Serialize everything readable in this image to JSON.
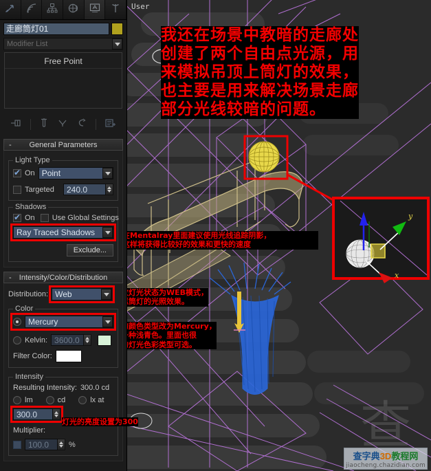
{
  "app": {
    "viewport_label": "User"
  },
  "command_panel": {
    "tabs": [
      {
        "name": "create",
        "icon": "arrow-pointer-icon"
      },
      {
        "name": "modify",
        "icon": "radiate-icon"
      },
      {
        "name": "hierarchy",
        "icon": "hierarchy-icon"
      },
      {
        "name": "motion",
        "icon": "motion-wheel-icon"
      },
      {
        "name": "display",
        "icon": "display-monitor-icon"
      },
      {
        "name": "utilities",
        "icon": "hammer-icon"
      }
    ],
    "object_name": "走廊筒灯01",
    "object_color": "#b0a11e",
    "modifier_list_placeholder": "Modifier List",
    "stack_item": "Free Point",
    "stack_tools": [
      {
        "name": "pin-stack-icon"
      },
      {
        "name": "show-end-result-icon"
      },
      {
        "name": "make-unique-icon"
      },
      {
        "name": "remove-modifier-icon"
      },
      {
        "name": "configure-sets-icon"
      }
    ]
  },
  "general_parameters": {
    "title": "General Parameters",
    "light_type": {
      "group_label": "Light Type",
      "on_label": "On",
      "on_checked": true,
      "type_value": "Point",
      "targeted_label": "Targeted",
      "targeted_checked": false,
      "target_distance": "240.0"
    },
    "shadows": {
      "group_label": "Shadows",
      "on_label": "On",
      "on_checked": true,
      "use_global_label": "Use Global Settings",
      "use_global_checked": false,
      "shadow_type": "Ray Traced Shadows",
      "shadow_type_highlighted": true,
      "exclude_label": "Exclude..."
    }
  },
  "intensity_color_distribution": {
    "title": "Intensity/Color/Distribution",
    "distribution_label": "Distribution:",
    "distribution_value": "Web",
    "distribution_highlighted": true,
    "color": {
      "group_label": "Color",
      "preset_selected": true,
      "preset_value": "Mercury",
      "preset_highlighted": true,
      "kelvin_label": "Kelvin:",
      "kelvin_value": "3600.0",
      "kelvin_selected": false,
      "kelvin_swatch": "#d8f2d8",
      "filter_color_label": "Filter Color:",
      "filter_color_swatch": "#ffffff"
    },
    "intensity": {
      "group_label": "Intensity",
      "resulting_label": "Resulting Intensity:",
      "resulting_value": "300.0 cd",
      "unit_lm": "lm",
      "unit_cd": "cd",
      "unit_lx": "lx at",
      "unit_selected": "cd",
      "value": "300.0",
      "value_highlighted": true,
      "multiplier_label": "Multiplier:",
      "multiplier_value": "100.0",
      "multiplier_percent": "%",
      "multiplier_enabled": false
    }
  },
  "annotations": {
    "main": "我还在场景中教暗的走廊处\n创建了两个自由点光源，用\n来模拟吊顶上筒灯的效果，\n也主要是用来解决场景走廊\n部分光线较暗的问题。",
    "shadow": "在Mentalray里面建议使用光线追踪阴影，\n这样将获得比较好的效果和更快的速度",
    "web": "更改灯光状态为WEB模式，\n模拟筒灯的光照效果。",
    "color": "灯的颜色类型改为Mercury，\n是一种浅青色。里面也很\n多的灯光色彩类型可选。",
    "intensity": "灯光的亮度设置为300",
    "color_hex": "#f30000"
  },
  "watermark": {
    "glyph": "查",
    "cn_pre": "查字典",
    "cn_mid": "3D",
    "cn_post": "教程网",
    "url": "jiaocheng.chazidian.com"
  },
  "viewport_scene": {
    "gizmo_axes": [
      {
        "name": "z-axis",
        "color": "#2222ee",
        "label": ""
      },
      {
        "name": "y-axis",
        "color": "#11bb11",
        "label": "y"
      },
      {
        "name": "x-axis",
        "color": "#dd1111",
        "label": "x"
      }
    ],
    "selected_light_color": "#e8d84a",
    "light_web_color": "#2a66d8",
    "wireframe_color": "#b06fd0",
    "geometry_color": "#cfc08a"
  }
}
